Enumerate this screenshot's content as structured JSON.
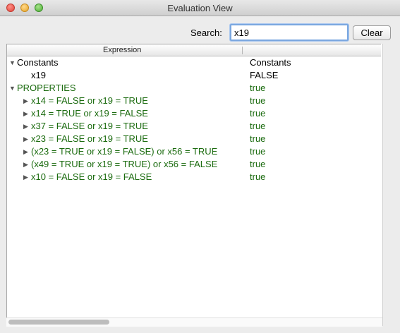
{
  "window": {
    "title": "Evaluation View"
  },
  "search": {
    "label": "Search:",
    "value": "x19",
    "clear_label": "Clear"
  },
  "table": {
    "headers": {
      "expression": "Expression"
    },
    "rows": [
      {
        "expression": "Constants",
        "value": "Constants",
        "disclosure": "open",
        "color": "black"
      },
      {
        "expression": "x19",
        "value": "FALSE",
        "disclosure": "none",
        "color": "black"
      },
      {
        "expression": "PROPERTIES",
        "value": "true",
        "disclosure": "open",
        "color": "green"
      },
      {
        "expression": "x14 = FALSE or x19 = TRUE",
        "value": "true",
        "disclosure": "closed",
        "color": "green"
      },
      {
        "expression": "x14 = TRUE or x19 = FALSE",
        "value": "true",
        "disclosure": "closed",
        "color": "green"
      },
      {
        "expression": "x37 = FALSE or x19 = TRUE",
        "value": "true",
        "disclosure": "closed",
        "color": "green"
      },
      {
        "expression": "x23 = FALSE or x19 = TRUE",
        "value": "true",
        "disclosure": "closed",
        "color": "green"
      },
      {
        "expression": "(x23 = TRUE or x19 = FALSE) or x56 = TRUE",
        "value": "true",
        "disclosure": "closed",
        "color": "green"
      },
      {
        "expression": "(x49 = TRUE or x19 = TRUE) or x56 = FALSE",
        "value": "true",
        "disclosure": "closed",
        "color": "green"
      },
      {
        "expression": "x10 = FALSE or x19 = FALSE",
        "value": "true",
        "disclosure": "closed",
        "color": "green"
      }
    ]
  },
  "colors": {
    "green_text": "#1b6b0f",
    "focus_ring": "#7aa7e0"
  },
  "icons": {
    "expanded": "disclosure-triangle-down-icon",
    "collapsed": "disclosure-triangle-right-icon"
  }
}
